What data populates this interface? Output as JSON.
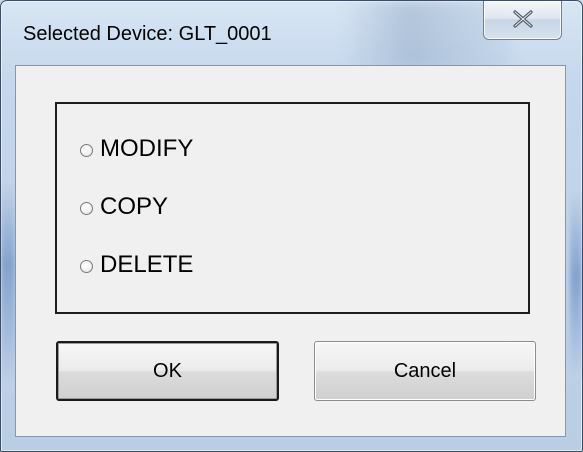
{
  "window": {
    "title": "Selected Device: GLT_0001"
  },
  "titlebar": {
    "close_icon": "close-x-icon"
  },
  "options": {
    "items": [
      {
        "label": "MODIFY",
        "selected": false
      },
      {
        "label": "COPY",
        "selected": false
      },
      {
        "label": "DELETE",
        "selected": false
      }
    ]
  },
  "buttons": {
    "ok_label": "OK",
    "cancel_label": "Cancel"
  }
}
